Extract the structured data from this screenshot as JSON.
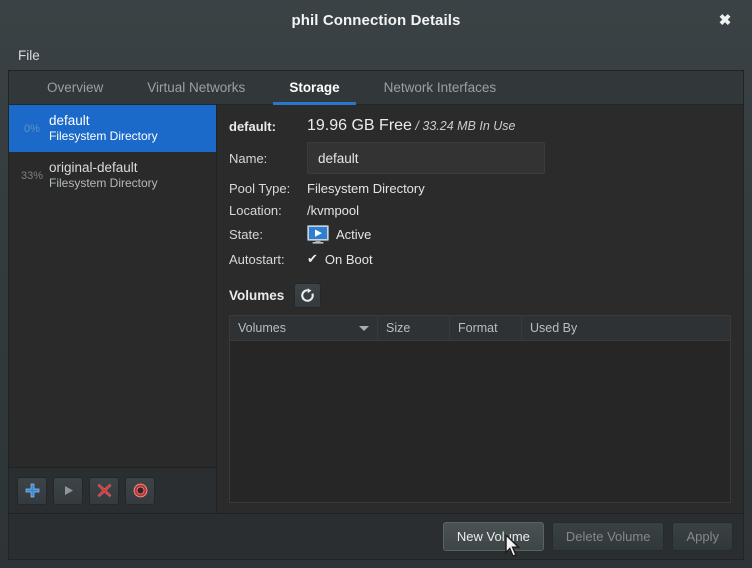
{
  "window": {
    "title": "phil Connection Details",
    "close_label": "✖"
  },
  "menubar": {
    "items": [
      {
        "label": "File"
      }
    ]
  },
  "tabs": [
    {
      "label": "Overview",
      "active": false
    },
    {
      "label": "Virtual Networks",
      "active": false
    },
    {
      "label": "Storage",
      "active": true
    },
    {
      "label": "Network Interfaces",
      "active": false
    }
  ],
  "sidebar": {
    "pools": [
      {
        "percent": "0%",
        "name": "default",
        "type": "Filesystem Directory",
        "selected": true
      },
      {
        "percent": "33%",
        "name": "original-default",
        "type": "Filesystem Directory",
        "selected": false
      }
    ],
    "toolbar": [
      {
        "name": "add-pool-button",
        "glyph": "+"
      },
      {
        "name": "start-pool-button",
        "glyph": "▶"
      },
      {
        "name": "delete-pool-button",
        "glyph": "✖"
      },
      {
        "name": "stop-pool-button",
        "glyph": "◉"
      }
    ]
  },
  "detail": {
    "pool_label": "default:",
    "free_value": "19.96 GB Free",
    "separator": " / ",
    "in_use": "33.24 MB In Use",
    "name_label": "Name:",
    "name_value": "default",
    "pool_type_label": "Pool Type:",
    "pool_type_value": "Filesystem Directory",
    "location_label": "Location:",
    "location_value": "/kvmpool",
    "state_label": "State:",
    "state_value": "Active",
    "autostart_label": "Autostart:",
    "autostart_value": "On Boot",
    "autostart_checked": "✔",
    "volumes_label": "Volumes"
  },
  "volumes_table": {
    "columns": [
      "Volumes",
      "Size",
      "Format",
      "Used By"
    ],
    "rows": []
  },
  "actions": [
    {
      "label": "New Volume",
      "state": "hover"
    },
    {
      "label": "Delete Volume",
      "state": "disabled"
    },
    {
      "label": "Apply",
      "state": "disabled"
    }
  ],
  "colors": {
    "accent_blue": "#2a76c8",
    "selection_blue": "#1b6ac9",
    "window_bg": "#2d3336",
    "panel_bg": "#2b2b2b",
    "table_bg": "#262626"
  }
}
